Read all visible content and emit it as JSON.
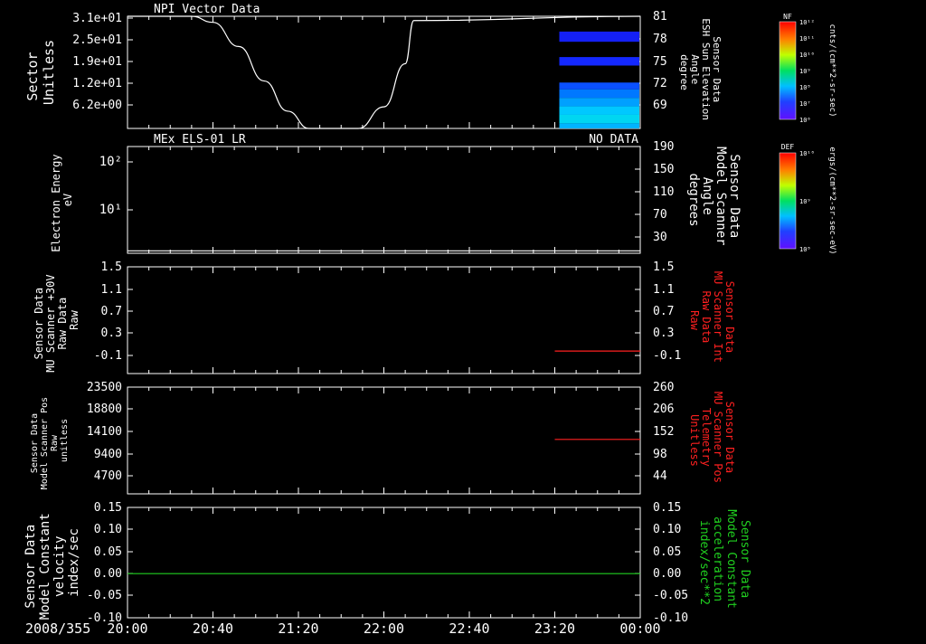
{
  "date_label": "2008/355",
  "time_ticks": [
    "20:00",
    "20:40",
    "21:20",
    "22:00",
    "22:40",
    "23:20",
    "00:00"
  ],
  "colors": {
    "background": "#000000",
    "axis": "#ffffff",
    "red_trace": "#ff2020",
    "green_trace": "#20d020"
  },
  "colorbars": [
    {
      "label": "NF",
      "tick_labels": [
        "10¹²",
        "10¹¹",
        "10¹⁰",
        "10⁹",
        "10⁸",
        "10⁷",
        "10⁶"
      ],
      "unit": "cnts/(cm**2-sr-sec)"
    },
    {
      "label": "DEF",
      "tick_labels": [
        "10¹⁰",
        "10⁹",
        "10⁸"
      ],
      "unit": "ergs/(cm**2-sr-sec-eV)"
    }
  ],
  "panels": [
    {
      "title_left": "NPI Vector Data",
      "title_right": "",
      "left_ylabel": [
        "Sector",
        "Unitless"
      ],
      "left_ticks": [
        "3.1e+01",
        "2.5e+01",
        "1.9e+01",
        "1.2e+01",
        "6.2e+00"
      ],
      "right_ylabel": [
        "Sensor Data",
        "ESH Sun Elevation",
        "Angle",
        "degree"
      ],
      "right_ticks": [
        "81",
        "78",
        "75",
        "72",
        "69"
      ],
      "right_color": "#ffffff"
    },
    {
      "title_left": "MEx ELS-01 LR",
      "title_right": "NO DATA",
      "left_ylabel": [
        "Electron Energy",
        "eV"
      ],
      "left_ticks": [
        "10²",
        "10¹"
      ],
      "right_ylabel": [
        "Sensor Data",
        "Model Scanner",
        "Angle",
        "degrees"
      ],
      "right_ticks": [
        "190",
        "150",
        "110",
        "70",
        "30"
      ],
      "right_color": "#ffffff"
    },
    {
      "title_left": "",
      "title_right": "",
      "left_ylabel": [
        "Sensor Data",
        "MU Scanner +30V",
        "Raw Data",
        "Raw"
      ],
      "left_ticks": [
        "1.5",
        "1.1",
        "0.7",
        "0.3",
        "-0.1"
      ],
      "right_ylabel": [
        "Sensor Data",
        "MU Scanner Int",
        "Raw Data",
        "Raw"
      ],
      "right_ticks": [
        "1.5",
        "1.1",
        "0.7",
        "0.3",
        "-0.1"
      ],
      "right_color": "#ff2020"
    },
    {
      "title_left": "",
      "title_right": "",
      "left_ylabel": [
        "Sensor Data",
        "Model Scanner Pos",
        "Raw",
        "unitless"
      ],
      "left_ticks": [
        "23500",
        "18800",
        "14100",
        "9400",
        "4700"
      ],
      "right_ylabel": [
        "Sensor Data",
        "MU Scanner Pos",
        "Telemetry",
        "Unitless"
      ],
      "right_ticks": [
        "260",
        "206",
        "152",
        "98",
        "44"
      ],
      "right_color": "#ff2020"
    },
    {
      "title_left": "",
      "title_right": "",
      "left_ylabel": [
        "Sensor Data",
        "Model Constant",
        "velocity",
        "index/sec"
      ],
      "left_ticks": [
        "0.15",
        "0.10",
        "0.05",
        "0.00",
        "-0.05",
        "-0.10"
      ],
      "right_ylabel": [
        "Sensor Data",
        "Model Constant",
        "acceleration",
        "index/sec**2"
      ],
      "right_ticks": [
        "0.15",
        "0.10",
        "0.05",
        "0.00",
        "-0.05",
        "-0.10"
      ],
      "right_color": "#20d020"
    }
  ],
  "chart_data": [
    {
      "type": "line",
      "panel": 0,
      "series": [
        {
          "x": [
            "20:00",
            "20:30",
            "20:40",
            "20:52",
            "21:04",
            "21:15",
            "21:25",
            "21:35",
            "21:48",
            "22:00",
            "22:10",
            "22:14",
            "00:00"
          ],
          "y": [
            81,
            81,
            80.3,
            77.5,
            73.5,
            70.0,
            68.0,
            68.0,
            68.0,
            70.5,
            75.5,
            80.5,
            81
          ],
          "color": "#ffffff"
        }
      ],
      "spectrogram": {
        "x_range": [
          "23:20",
          "00:00"
        ],
        "bands": [
          {
            "sector": [
              29.0,
              31.0
            ],
            "level": 0.0
          },
          {
            "sector": [
              25.5,
              28.5
            ],
            "level": 0.12
          },
          {
            "sector": [
              23.0,
              25.5
            ],
            "level": 0.0
          },
          {
            "sector": [
              18.5,
              21.0
            ],
            "level": 0.15
          },
          {
            "sector": [
              13.5,
              18.5
            ],
            "level": 0.0
          },
          {
            "sector": [
              11.5,
              13.5
            ],
            "level": 0.25
          },
          {
            "sector": [
              9.0,
              11.5
            ],
            "level": 0.35
          },
          {
            "sector": [
              6.5,
              9.0
            ],
            "level": 0.45
          },
          {
            "sector": [
              4.0,
              6.5
            ],
            "level": 0.55
          },
          {
            "sector": [
              1.5,
              4.0
            ],
            "level": 0.6
          },
          {
            "sector": [
              0.0,
              1.5
            ],
            "level": 0.5
          }
        ]
      }
    },
    {
      "type": "line",
      "panel": 1,
      "series": [
        {
          "x": [
            "20:00",
            "00:00"
          ],
          "y": [
            14,
            14
          ],
          "color": "#ffffff"
        }
      ],
      "right_ylim": [
        0,
        190
      ]
    },
    {
      "type": "line",
      "panel": 2,
      "series": [
        {
          "x": [
            "23:20",
            "00:00"
          ],
          "y": [
            0,
            0
          ],
          "color": "#ff2020"
        }
      ],
      "ylim": [
        -0.4,
        1.5
      ]
    },
    {
      "type": "line",
      "panel": 3,
      "series": [
        {
          "x": [
            "23:20",
            "00:00"
          ],
          "y": [
            9400,
            9400
          ],
          "color": "#ff2020"
        }
      ],
      "ylim": [
        0,
        23500
      ]
    },
    {
      "type": "line",
      "panel": 4,
      "series": [
        {
          "x": [
            "20:00",
            "00:00"
          ],
          "y": [
            0.0,
            0.0
          ],
          "color": "#20d020"
        }
      ],
      "ylim": [
        -0.1,
        0.15
      ]
    }
  ]
}
